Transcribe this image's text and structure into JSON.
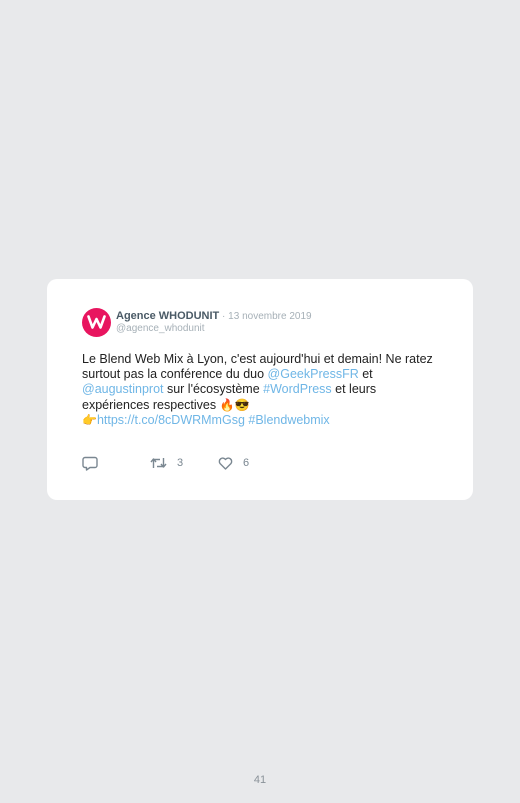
{
  "tweet": {
    "author_name": "Agence WHODUNIT",
    "separator": " · ",
    "date": "13 novembre 2019",
    "handle": "@agence_whodunit",
    "text": {
      "p1": "Le Blend Web Mix à Lyon, c'est aujourd'hui et demain! Ne ratez surtout pas la conférence du duo ",
      "mention1": "@GeekPressFR",
      "p2": " et ",
      "mention2": "@augustinprot",
      "p3": " sur l'écosystème ",
      "hashtag1": "#WordPress",
      "p4": " et leurs expériences respectives ",
      "emoji_fire": "🔥",
      "emoji_cool": "😎",
      "emoji_point": "👉",
      "url": "https://t.co/8cDWRMmGsg",
      "space": " ",
      "hashtag2": "#Blendwebmix"
    },
    "actions": {
      "reply_icon": "reply-icon",
      "retweet_icon": "retweet-icon",
      "retweet_count": "3",
      "like_icon": "heart-icon",
      "like_count": "6"
    }
  },
  "page_number": "41",
  "colors": {
    "background": "#e8e9eb",
    "card": "#ffffff",
    "brand": "#e8155f",
    "link": "#6fb6e6",
    "muted": "#a6b0b7"
  }
}
